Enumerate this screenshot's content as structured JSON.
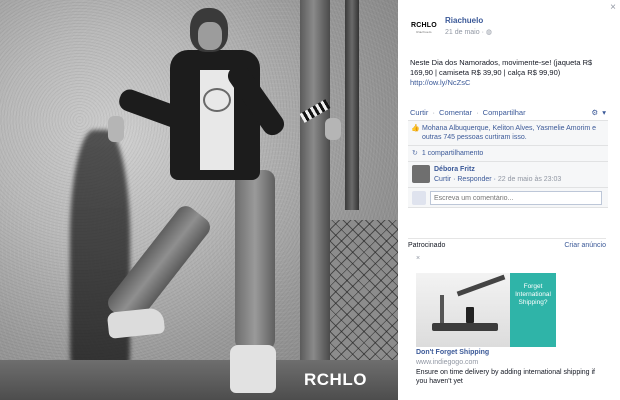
{
  "photo": {
    "brand_mark": "RCHLO"
  },
  "close": "×",
  "post": {
    "avatar_logo": "RCHLO",
    "avatar_sub": "Riachuelo",
    "page_name": "Riachuelo",
    "date": "21 de maio ·",
    "text": "Neste Dia dos Namorados, movimente-se! (jaqueta R$ 169,90 | camiseta R$ 39,90 | calça R$ 99,90)",
    "link": "http://ow.ly/NcZsC"
  },
  "actions": {
    "like": "Curtir",
    "comment": "Comentar",
    "share": "Compartilhar",
    "sep": "·"
  },
  "ufi": {
    "likes": "Mohana Albuquerque, Keliton Alves, Yasmelie Amorim e outras 745 pessoas curtiram isso.",
    "shares": "1 compartilhamento",
    "comment_name": "Débora Fritz",
    "comment_like": "Curtir",
    "comment_reply": "Responder",
    "comment_time": "22 de maio às 23:03",
    "write_placeholder": "Escreva um comentário..."
  },
  "sponsored": {
    "header": "Patrocinado",
    "create": "Criar anúncio",
    "close": "×",
    "ad_image_text": "Forget International Shipping?",
    "ad_title": "Don't Forget Shipping",
    "ad_url": "www.indiegogo.com",
    "ad_body": "Ensure on time delivery by adding international shipping if you haven't yet"
  },
  "colors": {
    "link": "#3b5998",
    "muted": "#9197a3",
    "ad_teal": "#2fb4a8"
  }
}
